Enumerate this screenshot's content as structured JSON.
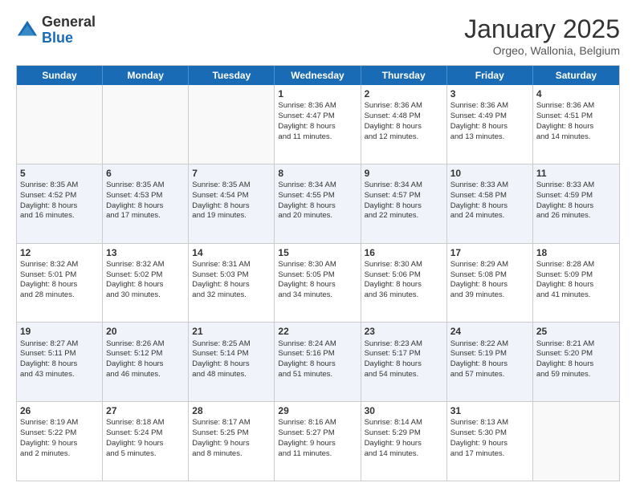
{
  "logo": {
    "general": "General",
    "blue": "Blue"
  },
  "header": {
    "month": "January 2025",
    "location": "Orgeo, Wallonia, Belgium"
  },
  "days_of_week": [
    "Sunday",
    "Monday",
    "Tuesday",
    "Wednesday",
    "Thursday",
    "Friday",
    "Saturday"
  ],
  "weeks": [
    [
      {
        "day": "",
        "info": ""
      },
      {
        "day": "",
        "info": ""
      },
      {
        "day": "",
        "info": ""
      },
      {
        "day": "1",
        "info": "Sunrise: 8:36 AM\nSunset: 4:47 PM\nDaylight: 8 hours\nand 11 minutes."
      },
      {
        "day": "2",
        "info": "Sunrise: 8:36 AM\nSunset: 4:48 PM\nDaylight: 8 hours\nand 12 minutes."
      },
      {
        "day": "3",
        "info": "Sunrise: 8:36 AM\nSunset: 4:49 PM\nDaylight: 8 hours\nand 13 minutes."
      },
      {
        "day": "4",
        "info": "Sunrise: 8:36 AM\nSunset: 4:51 PM\nDaylight: 8 hours\nand 14 minutes."
      }
    ],
    [
      {
        "day": "5",
        "info": "Sunrise: 8:35 AM\nSunset: 4:52 PM\nDaylight: 8 hours\nand 16 minutes."
      },
      {
        "day": "6",
        "info": "Sunrise: 8:35 AM\nSunset: 4:53 PM\nDaylight: 8 hours\nand 17 minutes."
      },
      {
        "day": "7",
        "info": "Sunrise: 8:35 AM\nSunset: 4:54 PM\nDaylight: 8 hours\nand 19 minutes."
      },
      {
        "day": "8",
        "info": "Sunrise: 8:34 AM\nSunset: 4:55 PM\nDaylight: 8 hours\nand 20 minutes."
      },
      {
        "day": "9",
        "info": "Sunrise: 8:34 AM\nSunset: 4:57 PM\nDaylight: 8 hours\nand 22 minutes."
      },
      {
        "day": "10",
        "info": "Sunrise: 8:33 AM\nSunset: 4:58 PM\nDaylight: 8 hours\nand 24 minutes."
      },
      {
        "day": "11",
        "info": "Sunrise: 8:33 AM\nSunset: 4:59 PM\nDaylight: 8 hours\nand 26 minutes."
      }
    ],
    [
      {
        "day": "12",
        "info": "Sunrise: 8:32 AM\nSunset: 5:01 PM\nDaylight: 8 hours\nand 28 minutes."
      },
      {
        "day": "13",
        "info": "Sunrise: 8:32 AM\nSunset: 5:02 PM\nDaylight: 8 hours\nand 30 minutes."
      },
      {
        "day": "14",
        "info": "Sunrise: 8:31 AM\nSunset: 5:03 PM\nDaylight: 8 hours\nand 32 minutes."
      },
      {
        "day": "15",
        "info": "Sunrise: 8:30 AM\nSunset: 5:05 PM\nDaylight: 8 hours\nand 34 minutes."
      },
      {
        "day": "16",
        "info": "Sunrise: 8:30 AM\nSunset: 5:06 PM\nDaylight: 8 hours\nand 36 minutes."
      },
      {
        "day": "17",
        "info": "Sunrise: 8:29 AM\nSunset: 5:08 PM\nDaylight: 8 hours\nand 39 minutes."
      },
      {
        "day": "18",
        "info": "Sunrise: 8:28 AM\nSunset: 5:09 PM\nDaylight: 8 hours\nand 41 minutes."
      }
    ],
    [
      {
        "day": "19",
        "info": "Sunrise: 8:27 AM\nSunset: 5:11 PM\nDaylight: 8 hours\nand 43 minutes."
      },
      {
        "day": "20",
        "info": "Sunrise: 8:26 AM\nSunset: 5:12 PM\nDaylight: 8 hours\nand 46 minutes."
      },
      {
        "day": "21",
        "info": "Sunrise: 8:25 AM\nSunset: 5:14 PM\nDaylight: 8 hours\nand 48 minutes."
      },
      {
        "day": "22",
        "info": "Sunrise: 8:24 AM\nSunset: 5:16 PM\nDaylight: 8 hours\nand 51 minutes."
      },
      {
        "day": "23",
        "info": "Sunrise: 8:23 AM\nSunset: 5:17 PM\nDaylight: 8 hours\nand 54 minutes."
      },
      {
        "day": "24",
        "info": "Sunrise: 8:22 AM\nSunset: 5:19 PM\nDaylight: 8 hours\nand 57 minutes."
      },
      {
        "day": "25",
        "info": "Sunrise: 8:21 AM\nSunset: 5:20 PM\nDaylight: 8 hours\nand 59 minutes."
      }
    ],
    [
      {
        "day": "26",
        "info": "Sunrise: 8:19 AM\nSunset: 5:22 PM\nDaylight: 9 hours\nand 2 minutes."
      },
      {
        "day": "27",
        "info": "Sunrise: 8:18 AM\nSunset: 5:24 PM\nDaylight: 9 hours\nand 5 minutes."
      },
      {
        "day": "28",
        "info": "Sunrise: 8:17 AM\nSunset: 5:25 PM\nDaylight: 9 hours\nand 8 minutes."
      },
      {
        "day": "29",
        "info": "Sunrise: 8:16 AM\nSunset: 5:27 PM\nDaylight: 9 hours\nand 11 minutes."
      },
      {
        "day": "30",
        "info": "Sunrise: 8:14 AM\nSunset: 5:29 PM\nDaylight: 9 hours\nand 14 minutes."
      },
      {
        "day": "31",
        "info": "Sunrise: 8:13 AM\nSunset: 5:30 PM\nDaylight: 9 hours\nand 17 minutes."
      },
      {
        "day": "",
        "info": ""
      }
    ]
  ]
}
